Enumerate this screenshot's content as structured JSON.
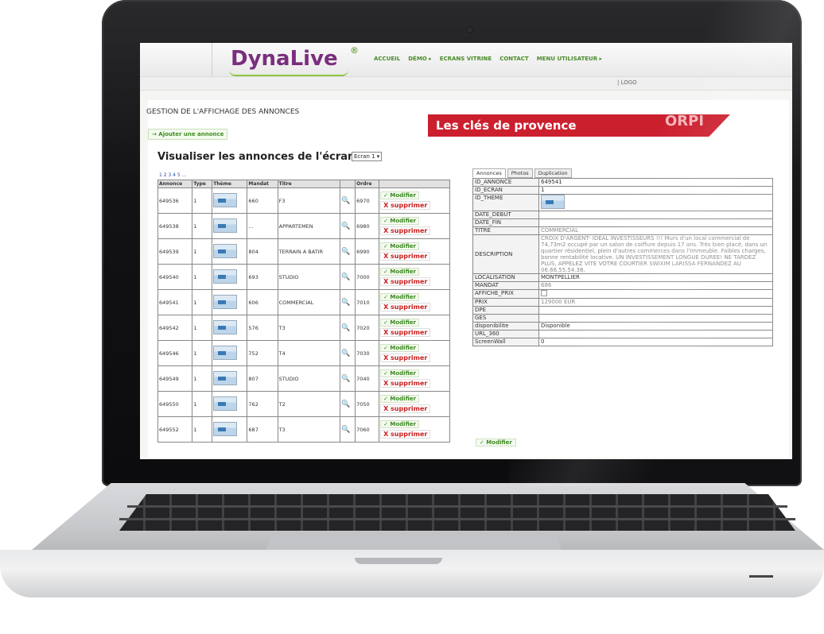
{
  "app": {
    "logo": "DynaLive",
    "logo_mark": "®",
    "nav": [
      "ACCUEIL",
      "DÉMO ▸",
      "ECRANS VITRINE",
      "CONTACT",
      "MENU UTILISATEUR ▸"
    ],
    "logout": "| LOGO"
  },
  "page": {
    "title": "GESTION DE L'AFFICHAGE DES ANNONCES",
    "add_button": "→ Ajouter une annonce",
    "banner": "Les clés de provence",
    "banner_logo": "ORPI",
    "visualize_title": "Visualiser les annonces de l'écran",
    "screen_select": "Ecran 1 ▾",
    "pager": "1 2 3 4 5 ..."
  },
  "table": {
    "headers": [
      "Annonce",
      "Type",
      "Thème",
      "Mandat",
      "Titre",
      "",
      "Ordre",
      ""
    ],
    "modify_label": "✓ Modifier",
    "delete_label": "X supprimer",
    "rows": [
      {
        "annonce": "649536",
        "type": "1",
        "mandat": "660",
        "titre": "F3",
        "ordre": "6970"
      },
      {
        "annonce": "649538",
        "type": "1",
        "mandat": "...",
        "titre": "APPARTEMEN",
        "ordre": "6980"
      },
      {
        "annonce": "649539",
        "type": "1",
        "mandat": "804",
        "titre": "TERRAIN A BATIR",
        "ordre": "6990"
      },
      {
        "annonce": "649540",
        "type": "1",
        "mandat": "693",
        "titre": "STUDIO",
        "ordre": "7000"
      },
      {
        "annonce": "649541",
        "type": "1",
        "mandat": "606",
        "titre": "COMMERCIAL",
        "ordre": "7010"
      },
      {
        "annonce": "649542",
        "type": "1",
        "mandat": "576",
        "titre": "T3",
        "ordre": "7020"
      },
      {
        "annonce": "649546",
        "type": "1",
        "mandat": "752",
        "titre": "T4",
        "ordre": "7030"
      },
      {
        "annonce": "649549",
        "type": "1",
        "mandat": "807",
        "titre": "STUDIO",
        "ordre": "7040"
      },
      {
        "annonce": "649550",
        "type": "1",
        "mandat": "762",
        "titre": "T2",
        "ordre": "7050"
      },
      {
        "annonce": "649552",
        "type": "1",
        "mandat": "687",
        "titre": "T3",
        "ordre": "7060"
      }
    ]
  },
  "detail": {
    "tabs": [
      "Annonces",
      "Photos",
      "Duplication"
    ],
    "rows": [
      {
        "key": "ID_ANNONCE",
        "value": "649541"
      },
      {
        "key": "ID_ECRAN",
        "value": "1"
      },
      {
        "key": "ID_THEME",
        "value": ""
      },
      {
        "key": "DATE_DEBUT",
        "value": ""
      },
      {
        "key": "DATE_FIN",
        "value": ""
      },
      {
        "key": "TITRE",
        "value": "COMMERCIAL"
      },
      {
        "key": "DESCRIPTION",
        "value": "CROIX D'ARGENT- IDEAL INVESTISSEURS !!! Murs d'un local commercial de 74,73m2 occupé par un salon de coiffure depuis 17 ans. Très bien placé, dans un quartier résidentiel, plein d'autres commerces dans l'immeuble. Faibles charges, bonne rentabilité locative. UN INVESTISSEMENT LONGUE DUREE! NE TARDEZ PLUS, APPELEZ VITE VOTRE COURTIER SWIXIM LARISSA FERNANDEZ AU 06.66.55.54.38."
      },
      {
        "key": "LOCALISATION",
        "value": "MONTPELLIER"
      },
      {
        "key": "MANDAT",
        "value": "686"
      },
      {
        "key": "AFFICHE_PRIX",
        "value": ""
      },
      {
        "key": "PRIX",
        "value": "129000 EUR"
      },
      {
        "key": "DPE",
        "value": ""
      },
      {
        "key": "GES",
        "value": ""
      },
      {
        "key": "disponibilite",
        "value": "Disponible"
      },
      {
        "key": "URL_360",
        "value": ""
      },
      {
        "key": "ScreenWall",
        "value": "0"
      }
    ],
    "modify_label": "✓ Modifier"
  }
}
